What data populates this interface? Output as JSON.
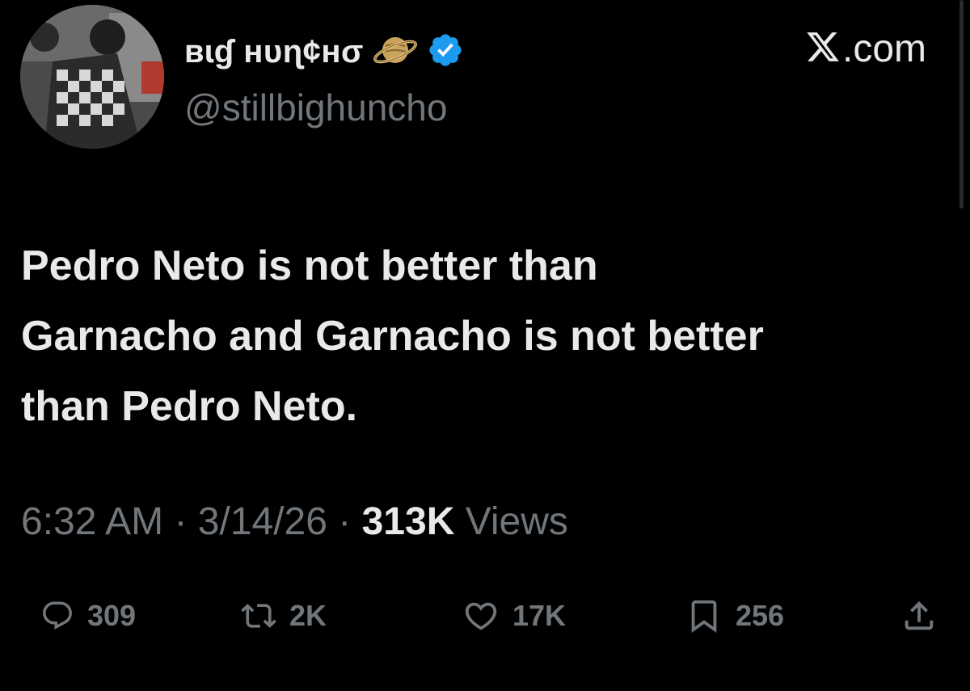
{
  "author": {
    "display_name": "ʙɩɠ ʜᴜɳ¢ʜσ",
    "handle": "@stillbighuncho",
    "verified": true,
    "name_emoji": "ringed-planet-icon",
    "avatar": "avatar-photo"
  },
  "brand": {
    "x_logo": "x-logo-icon",
    "suffix": ".com"
  },
  "tweet": {
    "text": "Pedro Neto is not better than\nGarnacho and Garnacho is not better\nthan Pedro Neto.",
    "time": "6:32 AM",
    "date": "3/14/26",
    "separator": "·",
    "views_count": "313K",
    "views_label": "Views"
  },
  "actions": {
    "replies": "309",
    "reposts": "2K",
    "likes": "17K",
    "bookmarks": "256"
  },
  "colors": {
    "background": "#000000",
    "text_primary": "#e7e9ea",
    "text_secondary": "#71767b",
    "verified_badge": "#1d9bf0"
  }
}
